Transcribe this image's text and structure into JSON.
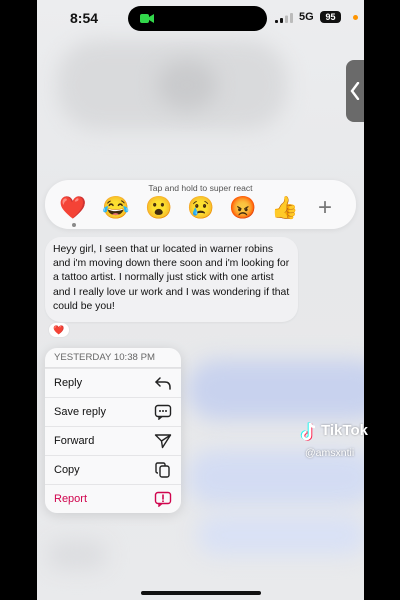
{
  "status_bar": {
    "time": "8:54",
    "network": "5G",
    "battery": "95"
  },
  "reactions": {
    "hint": "Tap and hold to super react",
    "items": [
      {
        "name": "red-heart",
        "glyph": "❤️"
      },
      {
        "name": "laughing-tears",
        "glyph": "😂"
      },
      {
        "name": "surprised",
        "glyph": "😮"
      },
      {
        "name": "crying",
        "glyph": "😢"
      },
      {
        "name": "angry",
        "glyph": "😡"
      },
      {
        "name": "thumbs-up",
        "glyph": "👍"
      }
    ],
    "more": "+"
  },
  "message": {
    "text": "Heyy girl, I seen that ur located in warner robins and i'm moving down there soon and i'm looking for a tattoo artist. I normally just stick with one artist and I really love ur work and I was wondering if that could be you!",
    "reaction": "❤️"
  },
  "menu": {
    "timestamp": "YESTERDAY 10:38 PM",
    "items": [
      {
        "label": "Reply",
        "icon": "reply-arrow-icon"
      },
      {
        "label": "Save reply",
        "icon": "chat-bubble-dots-icon"
      },
      {
        "label": "Forward",
        "icon": "paper-plane-icon"
      },
      {
        "label": "Copy",
        "icon": "copy-icon"
      },
      {
        "label": "Report",
        "icon": "report-exclamation-icon"
      }
    ]
  },
  "watermark": {
    "brand": "TikTok",
    "user": "@amsxntii"
  },
  "colors": {
    "danger": "#d0044d",
    "accent_heart": "#e0245e"
  }
}
